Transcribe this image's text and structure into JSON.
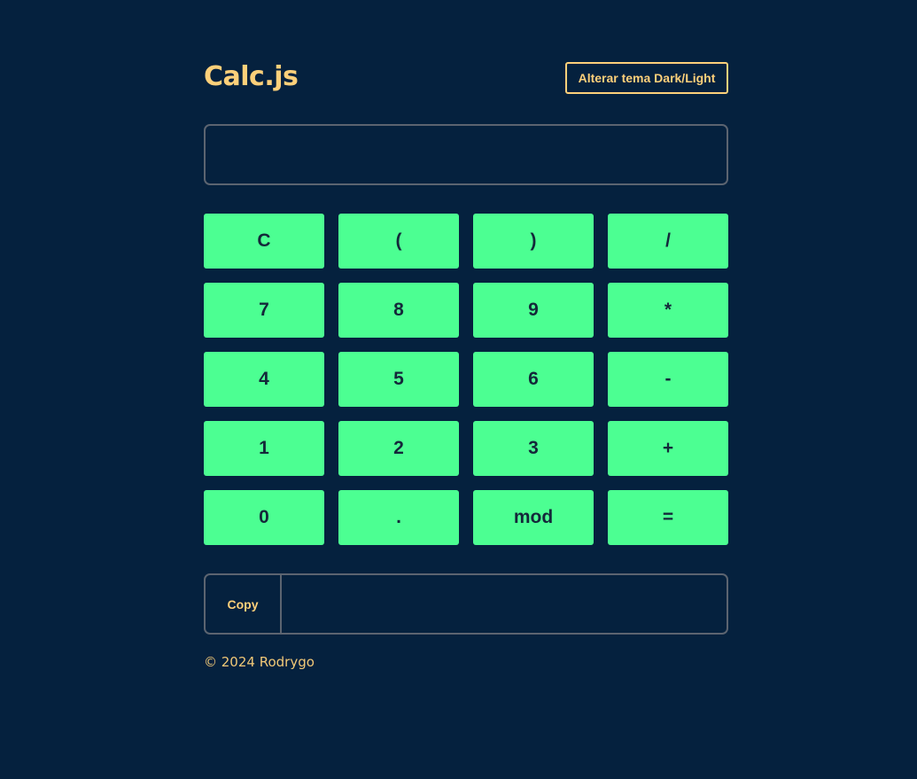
{
  "header": {
    "title": "Calc.js",
    "theme_toggle_label": "Alterar tema Dark/Light"
  },
  "display": {
    "value": "",
    "placeholder": ""
  },
  "keypad": {
    "keys": [
      {
        "label": "C",
        "name": "clear-key"
      },
      {
        "label": "(",
        "name": "open-paren-key"
      },
      {
        "label": ")",
        "name": "close-paren-key"
      },
      {
        "label": "/",
        "name": "divide-key"
      },
      {
        "label": "7",
        "name": "digit-7-key"
      },
      {
        "label": "8",
        "name": "digit-8-key"
      },
      {
        "label": "9",
        "name": "digit-9-key"
      },
      {
        "label": "*",
        "name": "multiply-key"
      },
      {
        "label": "4",
        "name": "digit-4-key"
      },
      {
        "label": "5",
        "name": "digit-5-key"
      },
      {
        "label": "6",
        "name": "digit-6-key"
      },
      {
        "label": "-",
        "name": "subtract-key"
      },
      {
        "label": "1",
        "name": "digit-1-key"
      },
      {
        "label": "2",
        "name": "digit-2-key"
      },
      {
        "label": "3",
        "name": "digit-3-key"
      },
      {
        "label": "+",
        "name": "add-key"
      },
      {
        "label": "0",
        "name": "digit-0-key"
      },
      {
        "label": ".",
        "name": "decimal-point-key"
      },
      {
        "label": "mod",
        "name": "modulo-key"
      },
      {
        "label": "=",
        "name": "equals-key"
      }
    ]
  },
  "result": {
    "copy_label": "Copy",
    "value": ""
  },
  "footer": {
    "text": "© 2024 Rodrygo"
  },
  "colors": {
    "background": "#05213e",
    "accent": "#fdd07a",
    "key": "#4cff92",
    "key_text": "#14283a",
    "border": "#5c6470"
  }
}
